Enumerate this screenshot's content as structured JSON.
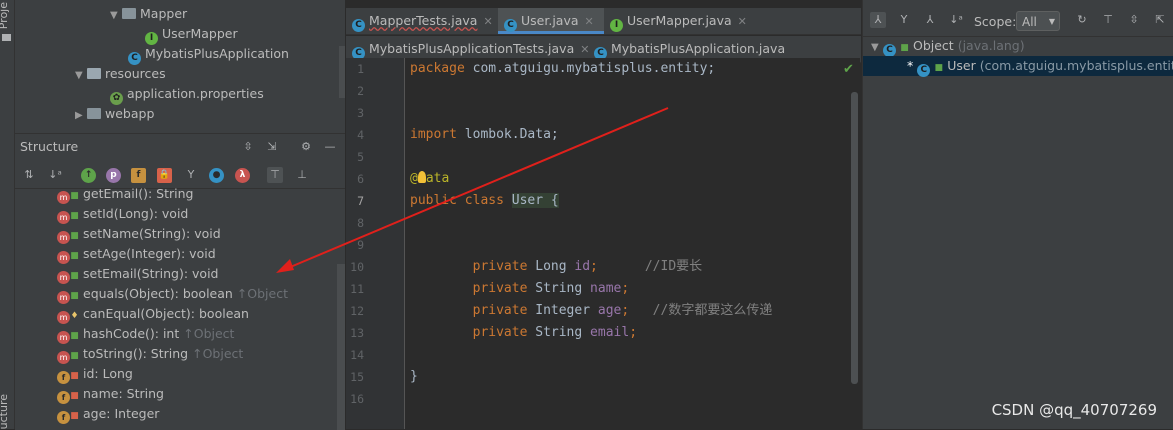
{
  "left_stripe": {
    "top_tab": "Proje",
    "bottom_tab": "ucture"
  },
  "project_tree": [
    {
      "label": "Mapper",
      "type": "folder",
      "expanded": true
    },
    {
      "label": "UserMapper",
      "type": "interface"
    },
    {
      "label": "MybatisPlusApplication",
      "type": "spring-class"
    },
    {
      "label": "resources",
      "type": "resource-folder",
      "expanded": true
    },
    {
      "label": "application.properties",
      "type": "properties"
    },
    {
      "label": "webapp",
      "type": "folder",
      "expanded": false
    }
  ],
  "structure": {
    "title": "Structure",
    "members": [
      {
        "label": "getEmail(): String",
        "inherit": "",
        "kind": "method",
        "visibility": "public"
      },
      {
        "label": "setId(Long): void",
        "inherit": "",
        "kind": "method",
        "visibility": "public"
      },
      {
        "label": "setName(String): void",
        "inherit": "",
        "kind": "method",
        "visibility": "public"
      },
      {
        "label": "setAge(Integer): void",
        "inherit": "",
        "kind": "method",
        "visibility": "public"
      },
      {
        "label": "setEmail(String): void",
        "inherit": "",
        "kind": "method",
        "visibility": "public"
      },
      {
        "label": "equals(Object): boolean",
        "inherit": "↑Object",
        "kind": "method",
        "visibility": "public"
      },
      {
        "label": "canEqual(Object): boolean",
        "inherit": "",
        "kind": "method",
        "visibility": "protected"
      },
      {
        "label": "hashCode(): int",
        "inherit": "↑Object",
        "kind": "method",
        "visibility": "public"
      },
      {
        "label": "toString(): String",
        "inherit": "↑Object",
        "kind": "method",
        "visibility": "public"
      },
      {
        "label": "id: Long",
        "inherit": "",
        "kind": "field",
        "visibility": "private"
      },
      {
        "label": "name: String",
        "inherit": "",
        "kind": "field",
        "visibility": "private"
      },
      {
        "label": "age: Integer",
        "inherit": "",
        "kind": "field",
        "visibility": "private"
      }
    ]
  },
  "editor": {
    "tabs_row1": [
      {
        "label": "MapperTests.java",
        "icon": "C",
        "active": false
      },
      {
        "label": "User.java",
        "icon": "C",
        "active": true
      },
      {
        "label": "UserMapper.java",
        "icon": "I",
        "active": false
      }
    ],
    "tabs_row2": [
      {
        "label": "MybatisPlusApplicationTests.java",
        "icon": "C",
        "active": false
      },
      {
        "label": "MybatisPlusApplication.java",
        "icon": "C",
        "active": false
      }
    ],
    "line_numbers": [
      "1",
      "2",
      "3",
      "4",
      "5",
      "6",
      "7",
      "8",
      "9",
      "10",
      "11",
      "12",
      "13",
      "14",
      "15",
      "16"
    ],
    "lines": {
      "l1_kw": "package ",
      "l1_rest": "com.atguigu.mybatisplus.entity;",
      "l4_kw": "import ",
      "l4_rest": "lombok.Data;",
      "l6_at": "@",
      "l6_ann": "ata",
      "l7_kw": "public class ",
      "l7_rest": "User {",
      "l10_kw": "private ",
      "l10_type": "Long ",
      "l10_fld": "id",
      "l10_semi": ";",
      "l10_cmt": "//ID要长",
      "l11_kw": "private ",
      "l11_type": "String ",
      "l11_fld": "name",
      "l11_semi": ";",
      "l12_kw": "private ",
      "l12_type": "Integer ",
      "l12_fld": "age",
      "l12_semi": ";",
      "l12_cmt": "//数字都要这么传递",
      "l13_kw": "private ",
      "l13_type": "String ",
      "l13_fld": "email",
      "l13_semi": ";",
      "l15": "}"
    }
  },
  "hierarchy": {
    "scope_label": "Scope:",
    "scope_value": "All",
    "root": {
      "label": "Object",
      "package": "(java.lang)"
    },
    "child": {
      "marker": "*",
      "label": "User",
      "package": "(com.atguigu.mybatisplus.entity)"
    }
  },
  "watermark": "CSDN @qq_40707269",
  "colors": {
    "keyword": "#cc7832",
    "annotation": "#bbb529",
    "field": "#9876aa",
    "comment": "#808080",
    "arrow": "#e0201b",
    "selection": "#0d293e"
  }
}
